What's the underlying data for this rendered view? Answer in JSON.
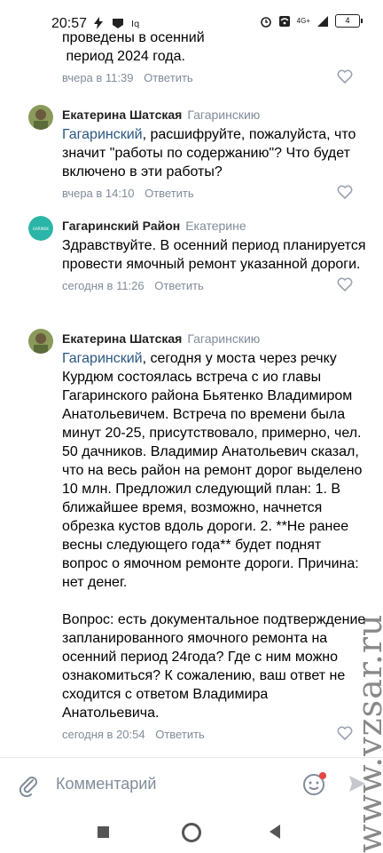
{
  "status_bar": {
    "time": "20:57",
    "left_icons": [
      "bolt-icon",
      "telegram-icon",
      "ig-icon"
    ],
    "network": "4G+",
    "battery": "4"
  },
  "comments": [
    {
      "text_lines": [
        "проведены в осенний",
        " период 2024 года."
      ],
      "time": "вчера в 11:39",
      "reply_label": "Ответить"
    },
    {
      "author": "Екатерина Шатская",
      "reply_to": "Гагаринскию",
      "mention": "Гагаринский",
      "text": ", расшифруйте, пожалуйста, что значит \"работы по содержанию\"? Что будет включено в эти работы?",
      "time": "вчера в 14:10",
      "reply_label": "Ответить"
    },
    {
      "author": "Гагаринский Район",
      "reply_to": "Екатерине",
      "avatar_text": "GARINSK",
      "text": "Здравствуйте. В осенний период планируется провести ямочный ремонт указанной дороги.",
      "time": "сегодня в 11:26",
      "reply_label": "Ответить"
    },
    {
      "author": "Екатерина Шатская",
      "reply_to": "Гагаринскию",
      "mention": "Гагаринский",
      "text": ", сегодня у моста через речку Курдюм состоялась встреча с ио главы Гагаринского района Бьятенко Владимиром Анатольевичем.  Встреча по времени была минут 20-25, присутствовало, примерно, чел. 50 дачников. Владимир Анатольевич сказал, что на весь район на ремонт дорог выделено 10 млн. Предложил следующий план: 1. В ближайшее время, возможно, начнется обрезка кустов вдоль дороги. 2. **Не ранее весны следующего года** будет поднят вопрос о ямочном ремонте дороги. Причина: нет денег.",
      "text2": "Вопрос: есть документальное подтверждение запланированного ямочного ремонта на осенний период 24года? Где с ним можно ознакомиться? К сожалению, ваш ответ не сходится с ответом Владимира Анатольевича.",
      "time": "сегодня в 20:54",
      "reply_label": "Ответить"
    }
  ],
  "composer": {
    "placeholder": "Комментарий"
  },
  "watermark": "www.vzsar.ru",
  "colors": {
    "link": "#2a5885",
    "meta": "#818c99"
  }
}
